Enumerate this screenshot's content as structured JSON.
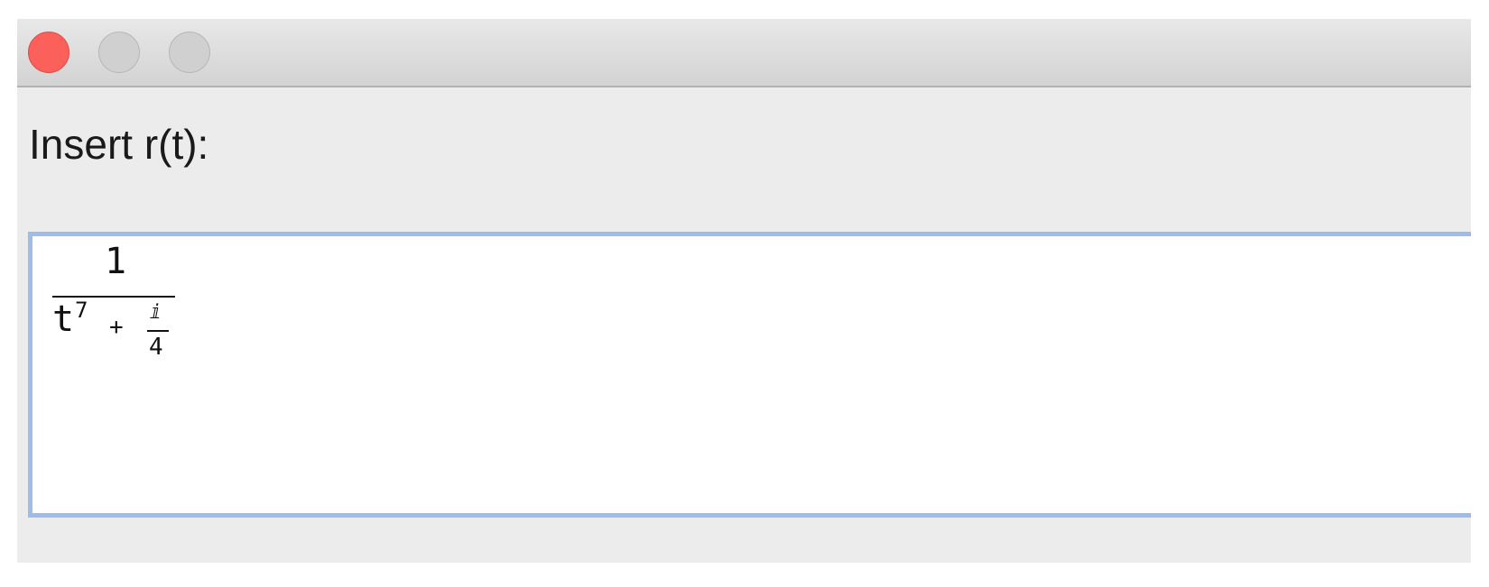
{
  "window": {
    "controls": {
      "close_color": "#fc605b",
      "minimize_color": "#d0d0d0",
      "zoom_color": "#d0d0d0"
    }
  },
  "dialog": {
    "prompt": "Insert r(t):",
    "expression": {
      "numerator": "1",
      "denominator_base": "t",
      "denominator_exponent": "7",
      "operator": "+",
      "fraction_numerator": "ⅈ",
      "fraction_denominator": "4"
    }
  }
}
